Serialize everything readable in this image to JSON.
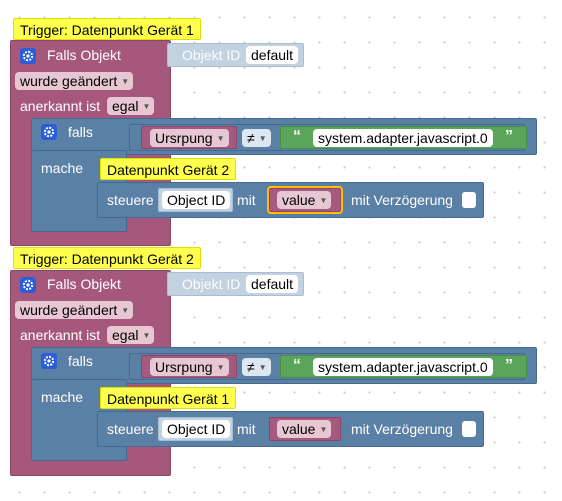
{
  "blocks": [
    {
      "comment": "Trigger: Datenpunkt Gerät 1",
      "falls_objekt": "Falls Objekt",
      "objekt_id_label": "Objekt ID",
      "objekt_id_value": "default",
      "event": "wurde geändert",
      "anerkannt_label": "anerkannt ist",
      "anerkannt_value": "egal",
      "if_label": "falls",
      "var": "Ursrpung",
      "op": "≠",
      "quote_open": "“",
      "quote_close": "”",
      "string": "system.adapter.javascript.0",
      "do_label": "mache",
      "do_comment": "Datenpunkt Gerät 2",
      "steuere": "steuere",
      "object_id": "Object ID",
      "mit": "mit",
      "value": "value",
      "delay": "mit Verzögerung"
    },
    {
      "comment": "Trigger: Datenpunkt Gerät 2",
      "falls_objekt": "Falls Objekt",
      "objekt_id_label": "Objekt ID",
      "objekt_id_value": "default",
      "event": "wurde geändert",
      "anerkannt_label": "anerkannt ist",
      "anerkannt_value": "egal",
      "if_label": "falls",
      "var": "Ursrpung",
      "op": "≠",
      "quote_open": "“",
      "quote_close": "”",
      "string": "system.adapter.javascript.0",
      "do_label": "mache",
      "do_comment": "Datenpunkt Gerät 1",
      "steuere": "steuere",
      "object_id": "Object ID",
      "mit": "mit",
      "value": "value",
      "delay": "mit Verzögerung"
    }
  ],
  "icons": {
    "gear": "gear-icon",
    "dropdown": "dropdown-arrow-icon"
  },
  "colors": {
    "trigger": "#a5587c",
    "logic": "#5b80a5",
    "text": "#5ba55b",
    "comment": "#ffff4d",
    "workspace": "#ffffff"
  }
}
